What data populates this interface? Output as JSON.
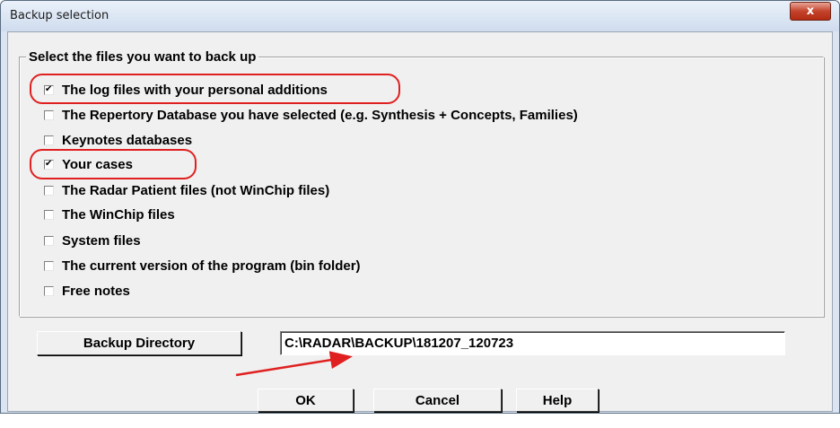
{
  "window": {
    "title": "Backup selection",
    "close_label": "x"
  },
  "group": {
    "legend": "Select the files you want to back up"
  },
  "options": [
    {
      "label": "The log files with your personal additions",
      "checked": true
    },
    {
      "label": "The Repertory Database you have selected (e.g. Synthesis + Concepts, Families)",
      "checked": false
    },
    {
      "label": "Keynotes databases",
      "checked": false
    },
    {
      "label": "Your cases",
      "checked": true
    },
    {
      "label": "The Radar Patient files (not WinChip files)",
      "checked": false
    },
    {
      "label": "The WinChip files",
      "checked": false
    },
    {
      "label": "System files",
      "checked": false
    },
    {
      "label": "The current version of the program (bin folder)",
      "checked": false
    },
    {
      "label": "Free notes",
      "checked": false
    }
  ],
  "backup": {
    "button_label": "Backup Directory",
    "path_value": "C:\\RADAR\\BACKUP\\181207_120723"
  },
  "footer": {
    "ok_label": "OK",
    "cancel_label": "Cancel",
    "help_label": "Help"
  },
  "annotation_color": "#e02020"
}
